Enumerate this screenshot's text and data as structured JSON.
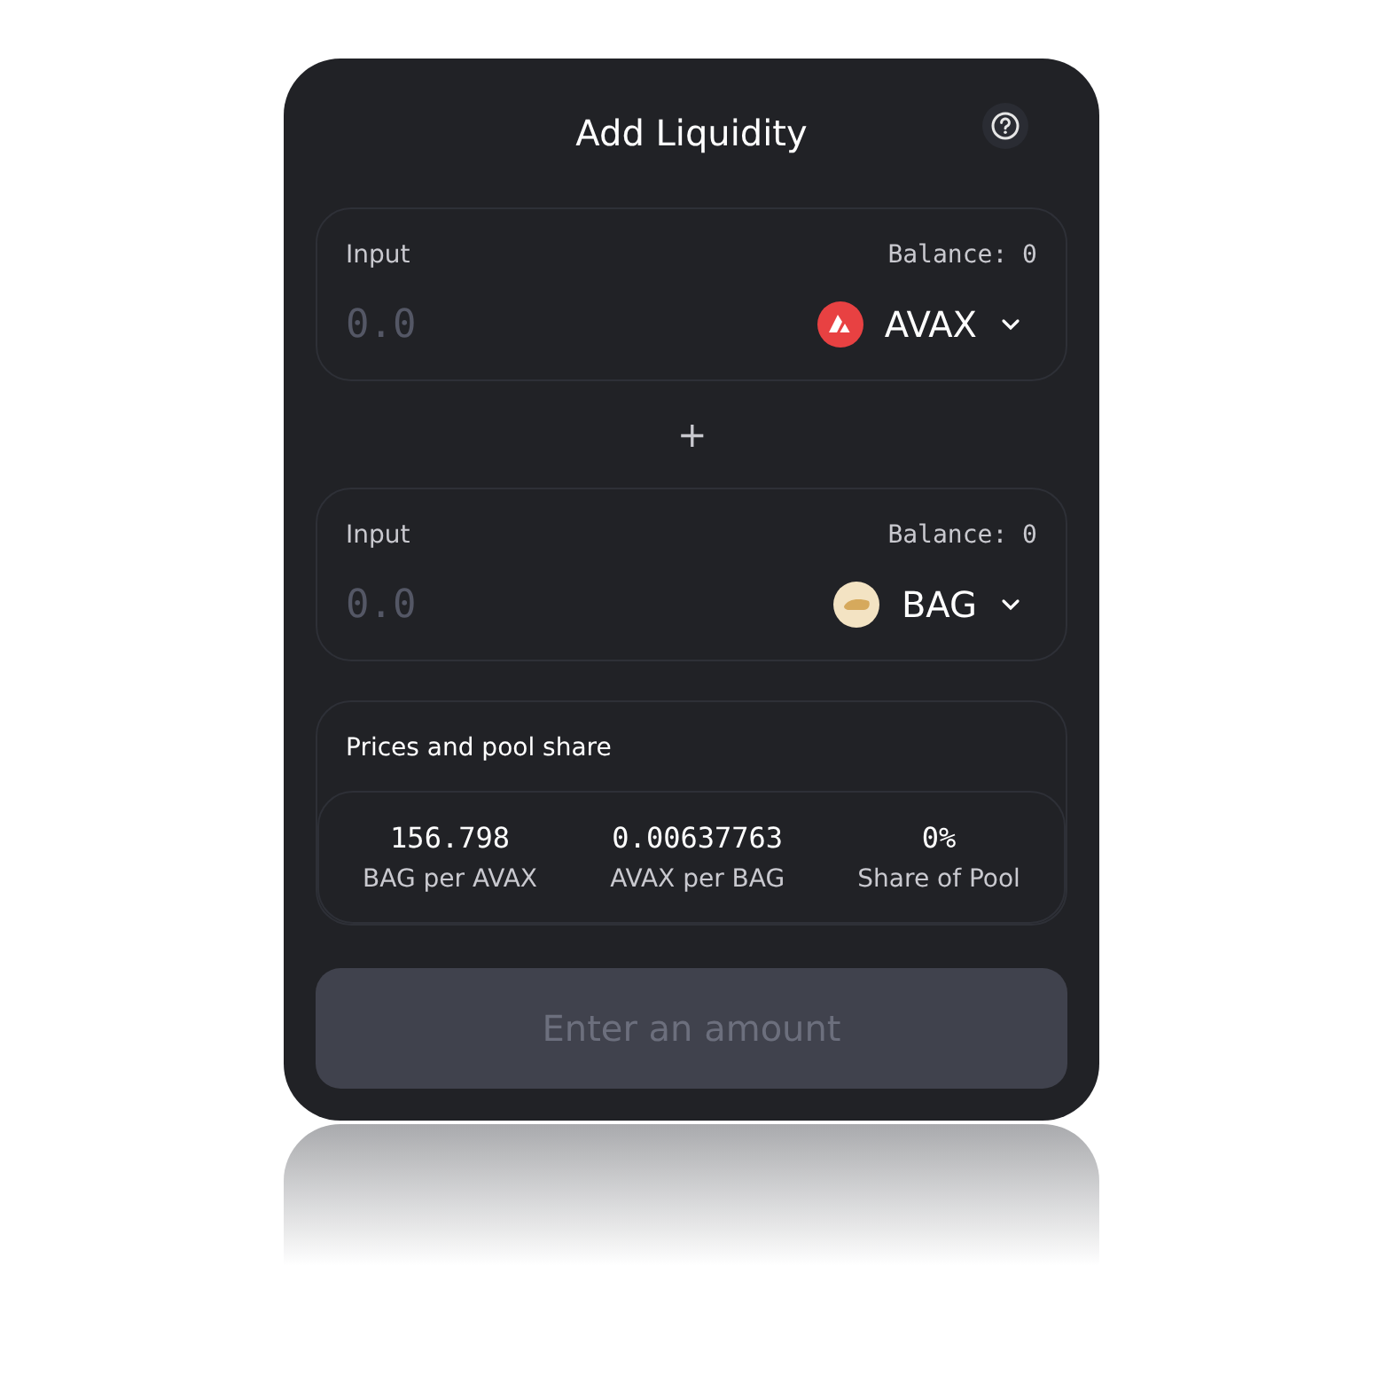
{
  "title": "Add Liquidity",
  "inputs": [
    {
      "label": "Input",
      "balance": "Balance: 0",
      "placeholder": "0.0",
      "token": "AVAX",
      "kind": "avax"
    },
    {
      "label": "Input",
      "balance": "Balance: 0",
      "placeholder": "0.0",
      "token": "BAG",
      "kind": "bag"
    }
  ],
  "separator": "+",
  "prices": {
    "title": "Prices and pool share",
    "items": [
      {
        "value": "156.798",
        "label": "BAG per AVAX"
      },
      {
        "value": "0.00637763",
        "label": "AVAX per BAG"
      },
      {
        "value": "0%",
        "label": "Share of Pool"
      }
    ]
  },
  "submit": {
    "label": "Enter an amount",
    "disabled": true
  }
}
